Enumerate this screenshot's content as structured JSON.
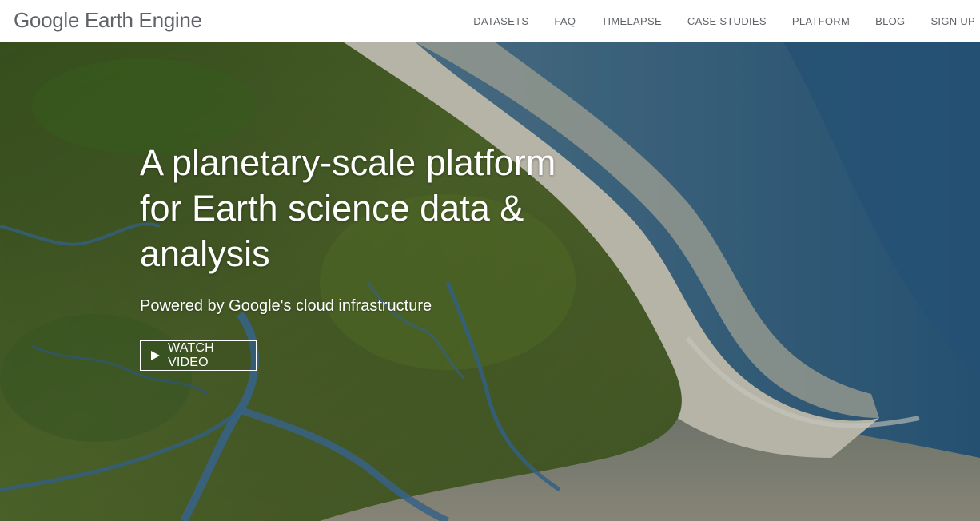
{
  "header": {
    "logo_text": "Google Earth Engine",
    "nav": [
      "DATASETS",
      "FAQ",
      "TIMELAPSE",
      "CASE STUDIES",
      "PLATFORM",
      "BLOG",
      "SIGN UP"
    ]
  },
  "hero": {
    "headline_lines": [
      "A planetary-scale platform",
      "for Earth science data &",
      "analysis"
    ],
    "subheadline": "Powered by Google's cloud infrastructure",
    "watch_button": {
      "label": "WATCH VIDEO",
      "icon": "play-icon"
    },
    "background": "aerial satellite image of a river delta meeting the sea"
  },
  "colors": {
    "header_bg": "#ffffff",
    "nav_text": "#5f6368",
    "hero_text": "#ffffff",
    "land": "#4e6a2c",
    "sand": "#c9c6b4",
    "water": "#2f5f80"
  }
}
